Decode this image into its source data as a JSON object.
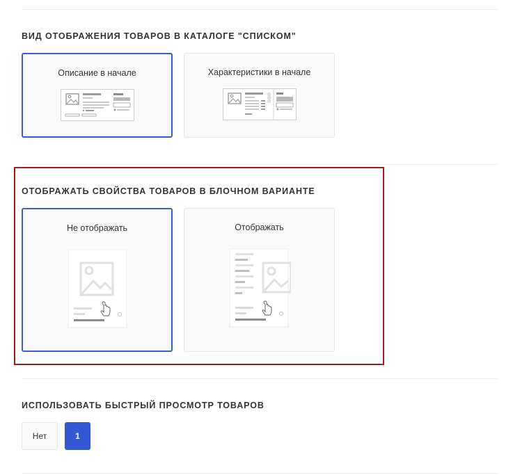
{
  "sections": [
    {
      "title": "ВИД ОТОБРАЖЕНИЯ ТОВАРОВ В КАТАЛОГЕ \"СПИСКОМ\"",
      "options": [
        {
          "label": "Описание в начале",
          "selected": true
        },
        {
          "label": "Характеристики в начале",
          "selected": false
        }
      ]
    },
    {
      "title": "ОТОБРАЖАТЬ СВОЙСТВА ТОВАРОВ В БЛОЧНОМ ВАРИАНТЕ",
      "options": [
        {
          "label": "Не отображать",
          "selected": true
        },
        {
          "label": "Отображать",
          "selected": false
        }
      ]
    },
    {
      "title": "ИСПОЛЬЗОВАТЬ БЫСТРЫЙ ПРОСМОТР ТОВАРОВ",
      "buttons": [
        {
          "label": "Нет",
          "selected": false
        },
        {
          "label": "1",
          "selected": true
        }
      ]
    }
  ],
  "colors": {
    "selected_border": "#3a5fc7",
    "active_button": "#3457d5",
    "highlight_frame": "#a01a1a"
  },
  "icons": [
    "image-placeholder-icon",
    "hand-cursor-icon"
  ]
}
